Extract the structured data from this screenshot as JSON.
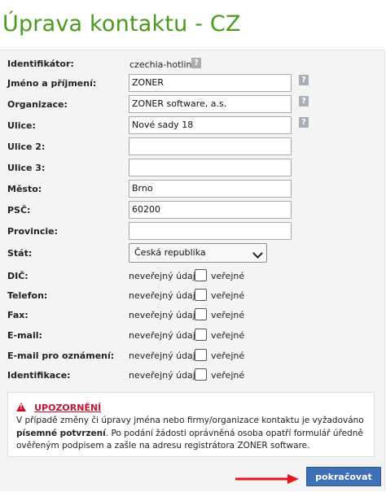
{
  "page": {
    "title": "Úprava kontaktu - CZ"
  },
  "help_glyph": "?",
  "identifier": {
    "label": "Identifikátor:",
    "value": "czechia-hotline"
  },
  "fields": {
    "name": {
      "label": "Jméno a příjmení:",
      "value": "ZONER"
    },
    "org": {
      "label": "Organizace:",
      "value": "ZONER software, a.s."
    },
    "street": {
      "label": "Ulice:",
      "value": "Nové sady 18"
    },
    "street2": {
      "label": "Ulice 2:",
      "value": ""
    },
    "street3": {
      "label": "Ulice 3:",
      "value": ""
    },
    "city": {
      "label": "Město:",
      "value": "Brno"
    },
    "zip": {
      "label": "PSČ:",
      "value": "60200"
    },
    "province": {
      "label": "Provincie:",
      "value": ""
    },
    "state": {
      "label": "Stát:",
      "value": "Česká republika"
    }
  },
  "privacy": {
    "non_public_label": "neveřejný údaj",
    "public_label": "veřejné",
    "rows": [
      {
        "label": "DIČ:",
        "checked": false
      },
      {
        "label": "Telefon:",
        "checked": false
      },
      {
        "label": "Fax:",
        "checked": false
      },
      {
        "label": "E-mail:",
        "checked": false
      },
      {
        "label": "E-mail pro oznámení:",
        "checked": false
      },
      {
        "label": "Identifikace:",
        "checked": false
      }
    ]
  },
  "warning": {
    "icon_glyph": "!",
    "title": "UPOZORNĚNÍ",
    "text_1": "V případě změny či úpravy jména nebo firmy/organizace kontaktu je vyžadováno",
    "text_bold": "písemné potvrzení",
    "text_2": ". Po podání žádosti oprávněná osoba opatří formulář úředně ověřeným podpisem a zašle na adresu registrátora ZONER software."
  },
  "submit": {
    "label": "pokračovat"
  },
  "colors": {
    "title": "#4a9a1e",
    "button": "#3f6fb4",
    "warning": "#c8102e",
    "arrow": "#e8141c"
  }
}
